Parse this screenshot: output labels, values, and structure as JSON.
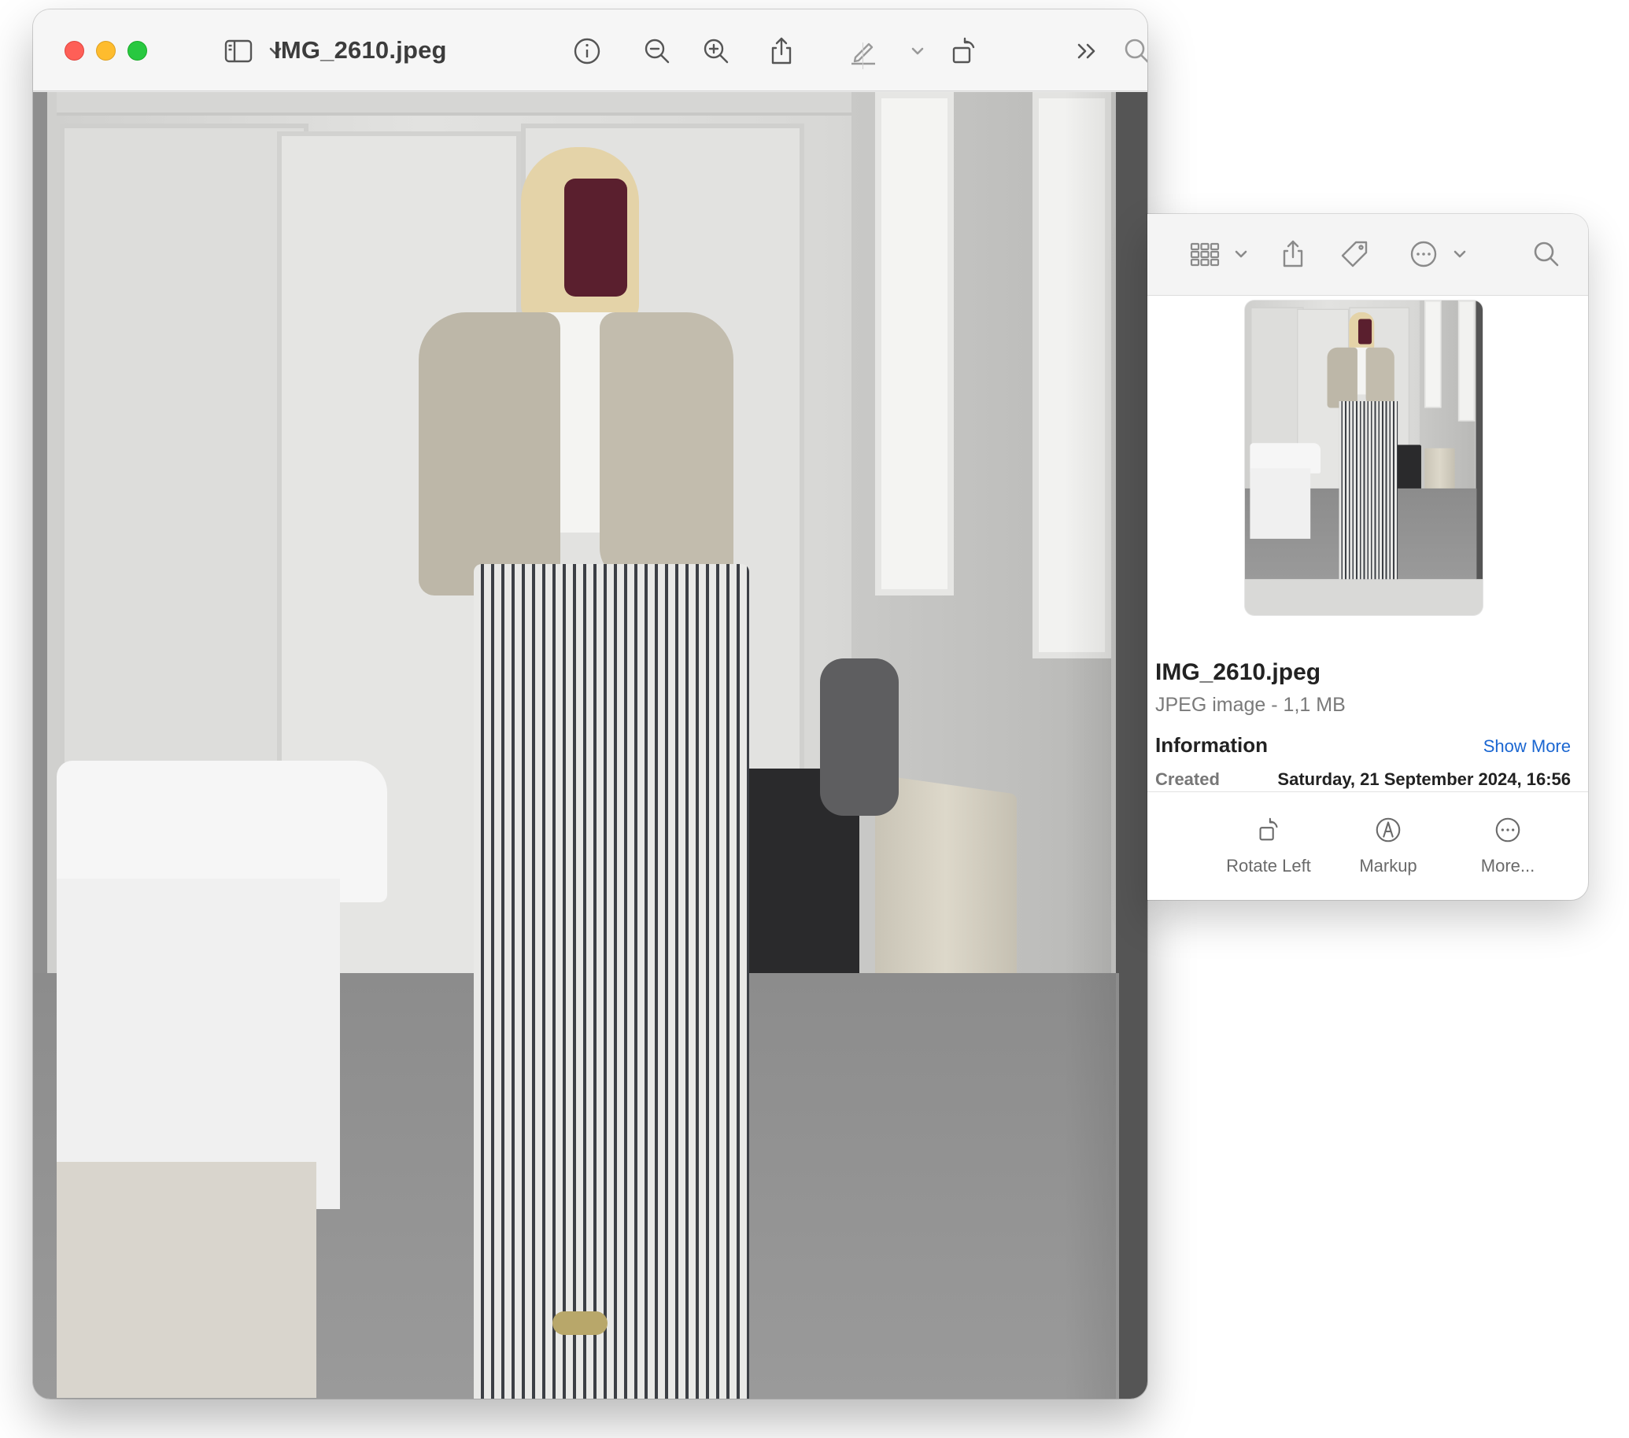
{
  "preview": {
    "title": "IMG_2610.jpeg",
    "toolbar": {
      "sidebar_icon": "sidebar-icon",
      "info_icon": "info-icon",
      "zoom_out_icon": "zoom-out-icon",
      "zoom_in_icon": "zoom-in-icon",
      "share_icon": "share-icon",
      "markup_icon": "markup-pen-icon",
      "rotate_icon": "rotate-icon",
      "overflow_icon": "chevron-double-right-icon",
      "search_icon": "search-icon"
    },
    "photo": "mirror selfie of a woman in a striped trouser outfit in a bedroom"
  },
  "info_panel": {
    "file_name": "IMG_2610.jpeg",
    "file_kind_size": "JPEG image - 1,1 MB",
    "section_title": "Information",
    "show_more": "Show More",
    "created_label": "Created",
    "created_value": "Saturday, 21 September 2024, 16:56",
    "actions": [
      {
        "label": "Rotate Left",
        "icon": "rotate-left-icon"
      },
      {
        "label": "Markup",
        "icon": "markup-icon"
      },
      {
        "label": "More...",
        "icon": "more-icon"
      }
    ]
  },
  "colors": {
    "close": "#fe5f57",
    "minimize": "#febc2e",
    "zoom": "#28c840",
    "link": "#1a66d1"
  }
}
